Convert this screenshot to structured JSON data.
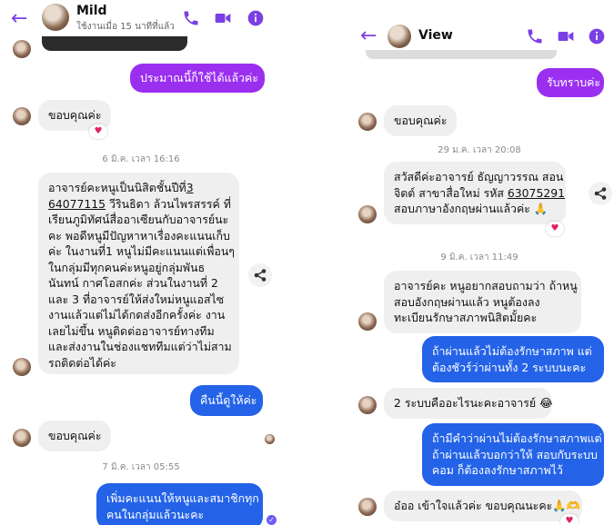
{
  "left": {
    "header": {
      "name": "Mild",
      "status": "ใช้งานเมื่อ 15 นาทีที่แล้ว"
    },
    "messages": {
      "m1": "ประมาณนี้ก็ใช้ได้แล้วค่ะ",
      "m2": "ขอบคุณค่ะ",
      "ts1": "6 มิ.ค. เวลา 16:16",
      "m3_pre": "อาจารย์คะหนูเป็นนิสิตชั้นปีที่",
      "m3_link_a": "3",
      "m3_link_b": "64077115",
      "m3_post": " วีรินธิดา ล้วนไพรสรรค์ ที่\nเรียนภูมิทัศน์สื่ออาเซียนกับอาจารย์นะ\nคะ พอดีหนูมีปัญหาหาเรื่องคะแนนเก็บ\nค่ะ ในงานที่1 หนูไม่มีคะแนนแต่เพื่อนๆ\nในกลุ่มมีทุกคนค่ะหนูอยู่กลุ่มพันธ\nนันทน์ กาศโอสกค่ะ ส่วนในงานที่ 2\nและ 3 ที่อาจารย์ให้ส่งใหม่หนูแอสไซ\nงานแล้วแต่ไม่ได้กดส่งอีกครั้งค่ะ งาน\nเลยไม่ขึ้น หนูติดต่ออาจารย์ทางทีม\nและส่งงานในช่องแชททีมแต่ว่าไม่สาม\nรถติดต่อได้ค่ะ",
      "m4": "คืนนี้ดูให้ค่ะ",
      "m5": "ขอบคุณค่ะ",
      "ts2": "7 มิ.ค. เวลา 05:55",
      "m6": "เพิ่มคะแนนให้หนูและสมาชิกทุก\nคนในกลุ่มแล้วนะคะ"
    }
  },
  "right": {
    "header": {
      "name": "View"
    },
    "messages": {
      "m1": "รับทราบค่ะ",
      "m2": "ขอบคุณค่ะ",
      "ts1": "29 ม.ค. เวลา 20:08",
      "m3_pre": "สวัสดีค่ะอาจารย์ ธัญญาวรรณ สอน\nจิตต์ สาขาสื่อใหม่ รหัส ",
      "m3_link": "63075291",
      "m3_post": "\nสอบภาษาอังกฤษผ่านแล้วค่ะ 🙏",
      "ts2": "9 มิ.ค. เวลา 11:49",
      "m4": "อาจารย์คะ หนูอยากสอบถามว่า ถ้าหนู\nสอบอังกฤษผ่านแล้ว หนูต้องลง\nทะเบียนรักษาสภาพนิสิตมั้ยคะ",
      "m5": "ถ้าผ่านแล้วไม่ต้องรักษาสภาพ แต่\nต้องชัวร์ว่าผ่านทั้ง 2 ระบบนะคะ",
      "m6": "2 ระบบคืออะไรนะคะอาจารย์ 😂",
      "m7": "ถ้ามีคำว่าผ่านไม่ต้องรักษาสภาพแต่\nถ้าผ่านแล้วบอกว่าให้ สอบกับระบบ\nคอม ก็ต้องลงรักษาสภาพไว้",
      "m8": "อ๋ออ เข้าใจแล้วค่ะ ขอบคุณนะคะ🙏🫶"
    }
  },
  "icons": {
    "back": "back-arrow-icon",
    "call": "phone-icon",
    "video": "video-camera-icon",
    "info": "info-icon",
    "share": "share-icon",
    "reaction": "heart-icon",
    "seen": "seen-check-icon"
  },
  "colors": {
    "accent": "#7b3fe4",
    "bubble_purple": "#9b2ff0",
    "bubble_blue": "#2463e8",
    "bubble_incoming": "#efefef",
    "reaction": "#e0245e"
  }
}
